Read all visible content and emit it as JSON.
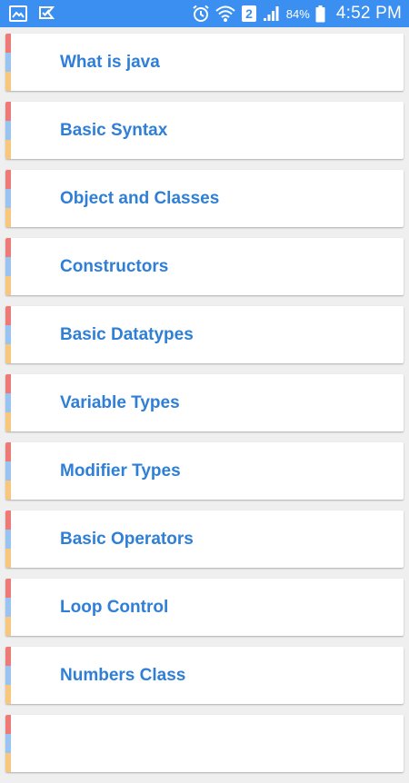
{
  "status_bar": {
    "icons": [
      "gallery-icon",
      "check-flag-icon",
      "alarm-icon",
      "wifi-icon",
      "sim-2-icon",
      "signal-icon",
      "battery-icon"
    ],
    "sim_slot": "2",
    "battery": "84%",
    "time": "4:52 PM"
  },
  "colors": {
    "status_bar": "#3b8ff0",
    "label": "#2f7fd6",
    "stripe_top": "#ee7a78",
    "stripe_mid": "#99c3f0",
    "stripe_bottom": "#f6c77c"
  },
  "topics": [
    {
      "label": "What is java"
    },
    {
      "label": "Basic Syntax"
    },
    {
      "label": "Object and Classes"
    },
    {
      "label": "Constructors"
    },
    {
      "label": "Basic Datatypes"
    },
    {
      "label": "Variable Types"
    },
    {
      "label": "Modifier Types"
    },
    {
      "label": "Basic Operators"
    },
    {
      "label": "Loop Control"
    },
    {
      "label": "Numbers Class"
    },
    {
      "label": ""
    }
  ]
}
